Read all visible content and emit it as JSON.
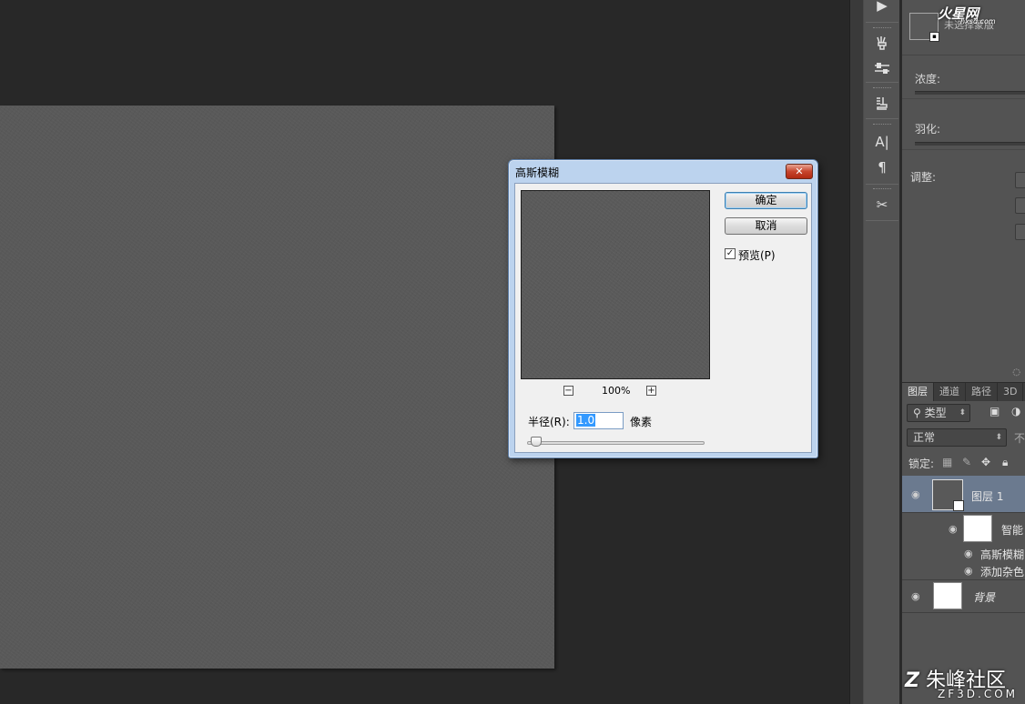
{
  "dialog": {
    "title": "高斯模糊",
    "close_label": "✕",
    "ok_label": "确定",
    "cancel_label": "取消",
    "preview_checkbox_label": "预览(P)",
    "preview_checked": true,
    "zoom_out": "−",
    "zoom_in": "+",
    "zoom_level": "100%",
    "radius_label": "半径(R):",
    "radius_value": "1.0",
    "radius_unit": "像素"
  },
  "toolbar": {
    "icons": [
      "play-icon",
      "brush-presets-icon",
      "tool-presets-icon",
      "clone-source-icon",
      "character-icon",
      "paragraph-icon",
      "tools-icon"
    ],
    "glyphs": {
      "play": "▶",
      "character": "A|",
      "paragraph": "¶",
      "tools": "✂"
    }
  },
  "properties": {
    "mask_title": "未选择蒙版",
    "density_label": "浓度:",
    "feather_label": "羽化:",
    "adjust_label": "调整:"
  },
  "layers_panel": {
    "tabs": [
      "图层",
      "通道",
      "路径",
      "3D"
    ],
    "filter_kind": "类型",
    "blend_mode": "正常",
    "opacity_fragment": "不",
    "lock_label": "锁定:",
    "layers": [
      {
        "name": "图层 1",
        "selected": true
      },
      {
        "name": "智能滤镜",
        "display": "智能"
      },
      {
        "name": "高斯模糊"
      },
      {
        "name": "添加杂色"
      },
      {
        "name": "背景"
      }
    ]
  },
  "watermarks": {
    "top": "火星网",
    "top_sub": "hxsd.com",
    "bottom": "朱峰社区",
    "bottom_sub": "ZF3D.COM"
  },
  "colors": {
    "workspace": "#282828",
    "panel": "#535353",
    "selected_layer": "#6b7a8f",
    "dialog_frame": "#bcd3ee"
  }
}
